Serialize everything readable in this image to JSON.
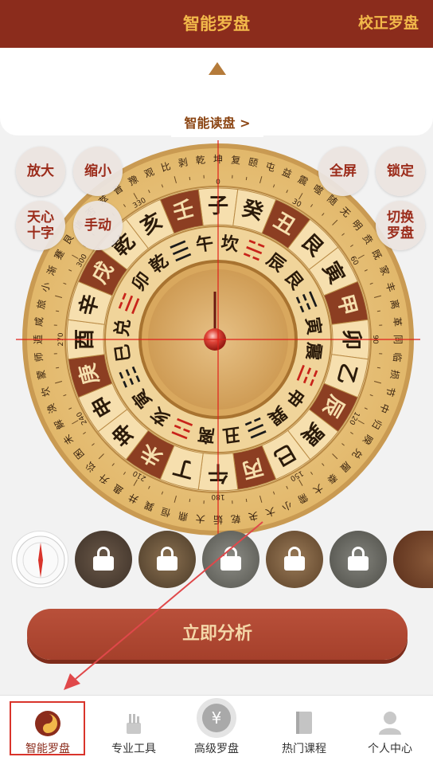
{
  "header": {
    "title": "智能罗盘",
    "calibrate_label": "校正罗盘"
  },
  "read_tab": {
    "label": "智能读盘 >"
  },
  "controls": {
    "zoom_in": "放大",
    "zoom_out": "缩小",
    "fullscreen": "全屏",
    "lock": "锁定",
    "crosshair_line1": "天心",
    "crosshair_line2": "十字",
    "manual": "手动",
    "switch_line1": "切换",
    "switch_line2": "罗盘"
  },
  "compass": {
    "mountains": [
      "子",
      "癸",
      "丑",
      "艮",
      "寅",
      "甲",
      "卯",
      "乙",
      "辰",
      "巽",
      "巳",
      "丙",
      "午",
      "丁",
      "未",
      "坤",
      "申",
      "庚",
      "酉",
      "辛",
      "戌",
      "乾",
      "亥",
      "壬"
    ],
    "inner_ring": [
      "坎",
      "☵",
      "辰",
      "艮",
      "☶",
      "寅",
      "震",
      "☳",
      "申",
      "巽",
      "☴",
      "丑",
      "离",
      "☲",
      "亥",
      "寅",
      "☷",
      "巳",
      "兑",
      "☱",
      "卯",
      "乾",
      "☰",
      "午"
    ],
    "degree_labels": [
      "0",
      "30",
      "60",
      "90",
      "120",
      "150",
      "180",
      "210",
      "240",
      "270",
      "300",
      "330"
    ],
    "outer_words": [
      "坤",
      "复",
      "颐",
      "屯",
      "益",
      "震",
      "噬",
      "随",
      "无",
      "明",
      "贲",
      "既",
      "家",
      "丰",
      "离",
      "革",
      "同",
      "临",
      "损",
      "节",
      "中",
      "归",
      "睽",
      "兑",
      "履",
      "泰",
      "大",
      "需",
      "小",
      "大",
      "夬",
      "乾",
      "姤",
      "大",
      "鼎",
      "恒",
      "巽",
      "井",
      "蛊",
      "升",
      "讼",
      "困",
      "未",
      "解",
      "涣",
      "坎",
      "蒙",
      "师",
      "遁",
      "咸",
      "旅",
      "小",
      "渐",
      "蹇",
      "艮",
      "谦",
      "否",
      "萃",
      "晋",
      "豫",
      "观",
      "比",
      "剥",
      "乾"
    ]
  },
  "analyze_button": {
    "label": "立即分析"
  },
  "tabs": [
    {
      "label": "智能罗盘",
      "icon": "yin-yang-icon",
      "active": true
    },
    {
      "label": "专业工具",
      "icon": "tools-icon",
      "active": false
    },
    {
      "label": "高级罗盘",
      "icon": "yuan-coin-icon",
      "active": false
    },
    {
      "label": "热门课程",
      "icon": "book-icon",
      "active": false
    },
    {
      "label": "个人中心",
      "icon": "person-icon",
      "active": false
    }
  ],
  "colors": {
    "header": "#8b2c1c",
    "accent": "#f2b84a",
    "button": "#a5402b",
    "highlight": "#d9342b"
  }
}
